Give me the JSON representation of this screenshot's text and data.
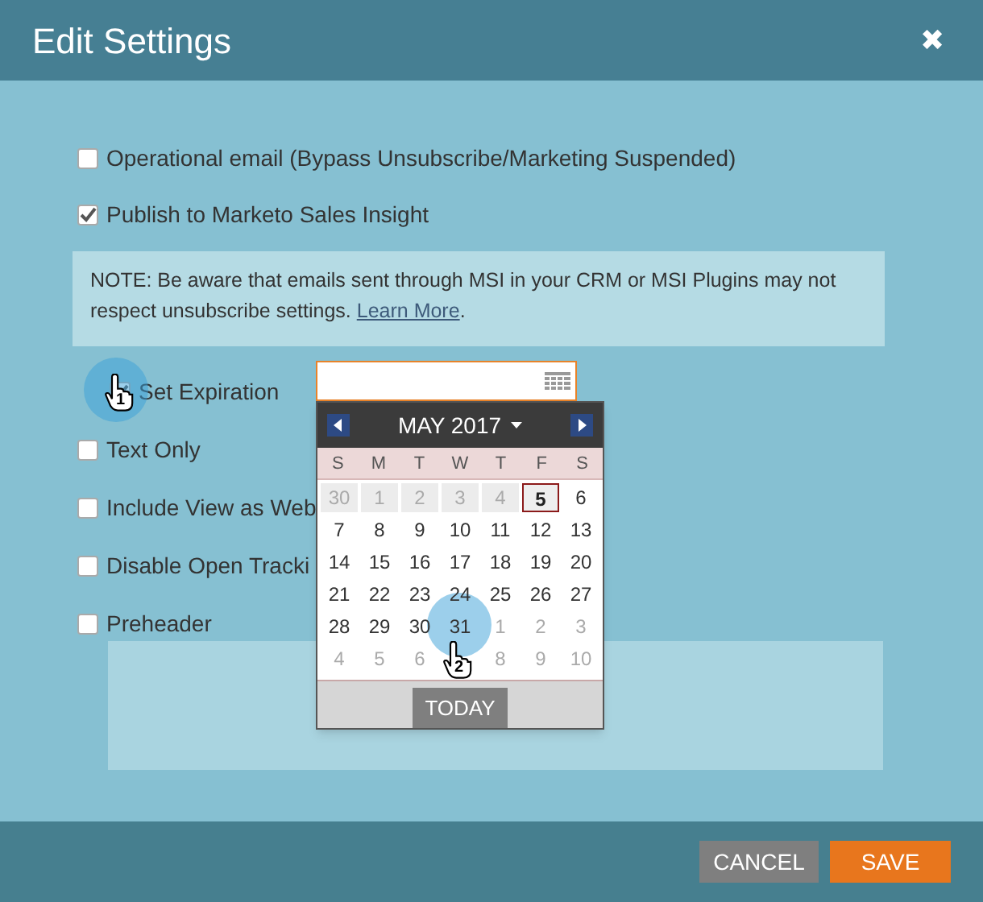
{
  "window": {
    "title": "Edit Settings",
    "close": "✖"
  },
  "options": [
    {
      "label": "Operational email (Bypass Unsubscribe/Marketing Suspended)",
      "checked": false
    },
    {
      "label": "Publish to Marketo Sales Insight",
      "checked": true
    }
  ],
  "note": {
    "text": "NOTE:  Be aware that emails sent through MSI in your CRM or MSI Plugins may not respect unsubscribe settings. ",
    "link": "Learn More",
    "after": "."
  },
  "expiration": {
    "label": "Set Expiration",
    "checked": true
  },
  "more_options": [
    {
      "label": "Text Only",
      "checked": false
    },
    {
      "label": "Include View as Web",
      "checked": false
    },
    {
      "label": "Disable Open Tracki",
      "checked": false
    },
    {
      "label": "Preheader",
      "checked": false
    }
  ],
  "calendar": {
    "month": "MAY 2017",
    "weekdays": [
      "S",
      "M",
      "T",
      "W",
      "T",
      "F",
      "S"
    ],
    "weeks": [
      [
        {
          "day": "30",
          "kind": "past"
        },
        {
          "day": "1",
          "kind": "past"
        },
        {
          "day": "2",
          "kind": "past"
        },
        {
          "day": "3",
          "kind": "past"
        },
        {
          "day": "4",
          "kind": "past"
        },
        {
          "day": "5",
          "kind": "today"
        },
        {
          "day": "6",
          "kind": "day"
        }
      ],
      [
        {
          "day": "7",
          "kind": "day"
        },
        {
          "day": "8",
          "kind": "day"
        },
        {
          "day": "9",
          "kind": "day"
        },
        {
          "day": "10",
          "kind": "day"
        },
        {
          "day": "11",
          "kind": "day"
        },
        {
          "day": "12",
          "kind": "day"
        },
        {
          "day": "13",
          "kind": "day"
        }
      ],
      [
        {
          "day": "14",
          "kind": "day"
        },
        {
          "day": "15",
          "kind": "day"
        },
        {
          "day": "16",
          "kind": "day"
        },
        {
          "day": "17",
          "kind": "day"
        },
        {
          "day": "18",
          "kind": "day"
        },
        {
          "day": "19",
          "kind": "day"
        },
        {
          "day": "20",
          "kind": "day"
        }
      ],
      [
        {
          "day": "21",
          "kind": "day"
        },
        {
          "day": "22",
          "kind": "day"
        },
        {
          "day": "23",
          "kind": "day"
        },
        {
          "day": "24",
          "kind": "day"
        },
        {
          "day": "25",
          "kind": "day"
        },
        {
          "day": "26",
          "kind": "day"
        },
        {
          "day": "27",
          "kind": "day"
        }
      ],
      [
        {
          "day": "28",
          "kind": "day"
        },
        {
          "day": "29",
          "kind": "day"
        },
        {
          "day": "30",
          "kind": "day"
        },
        {
          "day": "31",
          "kind": "day"
        },
        {
          "day": "1",
          "kind": "other"
        },
        {
          "day": "2",
          "kind": "other"
        },
        {
          "day": "3",
          "kind": "other"
        }
      ],
      [
        {
          "day": "4",
          "kind": "other"
        },
        {
          "day": "5",
          "kind": "other"
        },
        {
          "day": "6",
          "kind": "other"
        },
        {
          "kind": "other"
        },
        {
          "day": "8",
          "kind": "other"
        },
        {
          "day": "9",
          "kind": "other"
        },
        {
          "day": "10",
          "kind": "other"
        }
      ]
    ],
    "today_button": "TODAY"
  },
  "steps": [
    "1",
    "2"
  ],
  "buttons": [
    {
      "label": "CANCEL",
      "kind": "secondary"
    },
    {
      "label": "SAVE",
      "kind": "primary"
    }
  ]
}
